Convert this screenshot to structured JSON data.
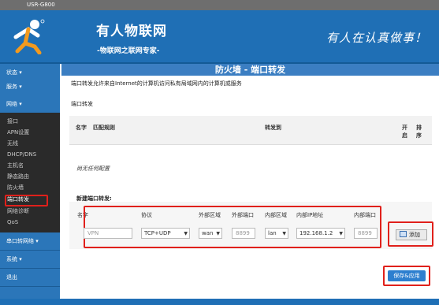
{
  "window": {
    "title": "USR-G800"
  },
  "header": {
    "site_name": "有人物联网",
    "site_sub": "-物联网之联网专家-",
    "slogan": "有人在认真做事！"
  },
  "sidebar": {
    "top_items": [
      {
        "label": "状态 ▾"
      },
      {
        "label": "服务 ▾"
      },
      {
        "label": "网络 ▾"
      }
    ],
    "network_sub": [
      {
        "label": "接口"
      },
      {
        "label": "APN设置"
      },
      {
        "label": "无线"
      },
      {
        "label": "DHCP/DNS"
      },
      {
        "label": "主机名"
      },
      {
        "label": "静态路由"
      },
      {
        "label": "防火墙"
      },
      {
        "label": "端口转发"
      },
      {
        "label": "网络诊断"
      },
      {
        "label": "QoS"
      }
    ],
    "bottom_items": [
      {
        "label": "串口转网络 ▾"
      },
      {
        "label": "系统 ▾"
      },
      {
        "label": "退出"
      }
    ]
  },
  "main": {
    "heading": "防火墙 - 端口转发",
    "description": "端口转发允许来自Internet的计算机访问私有局域网内的计算机或服务",
    "section_label": "端口转发",
    "table_headers": {
      "name": "名字",
      "match_rule": "匹配规则",
      "forward_to": "转发到",
      "enable": "开启",
      "sort": "排序"
    },
    "empty_text": "尚无任何配置",
    "new_forward": {
      "title": "新建端口转发:",
      "labels": {
        "name": "名字",
        "protocol": "协议",
        "external_zone": "外部区域",
        "external_port": "外部端口",
        "internal_zone": "内部区域",
        "internal_ip": "内部IP地址",
        "internal_port": "内部端口"
      },
      "values": {
        "name_placeholder": "VPN",
        "protocol": "TCP+UDP",
        "external_zone": "wan",
        "external_port_placeholder": "8899",
        "internal_zone": "lan",
        "internal_ip": "192.168.1.2",
        "internal_port_placeholder": "8899"
      },
      "add_label": "添加"
    },
    "save_label": "保存&应用"
  },
  "colors": {
    "brand_blue": "#1f6fb5",
    "highlight_red": "#e0201b",
    "button_blue": "#2d7fcf"
  }
}
